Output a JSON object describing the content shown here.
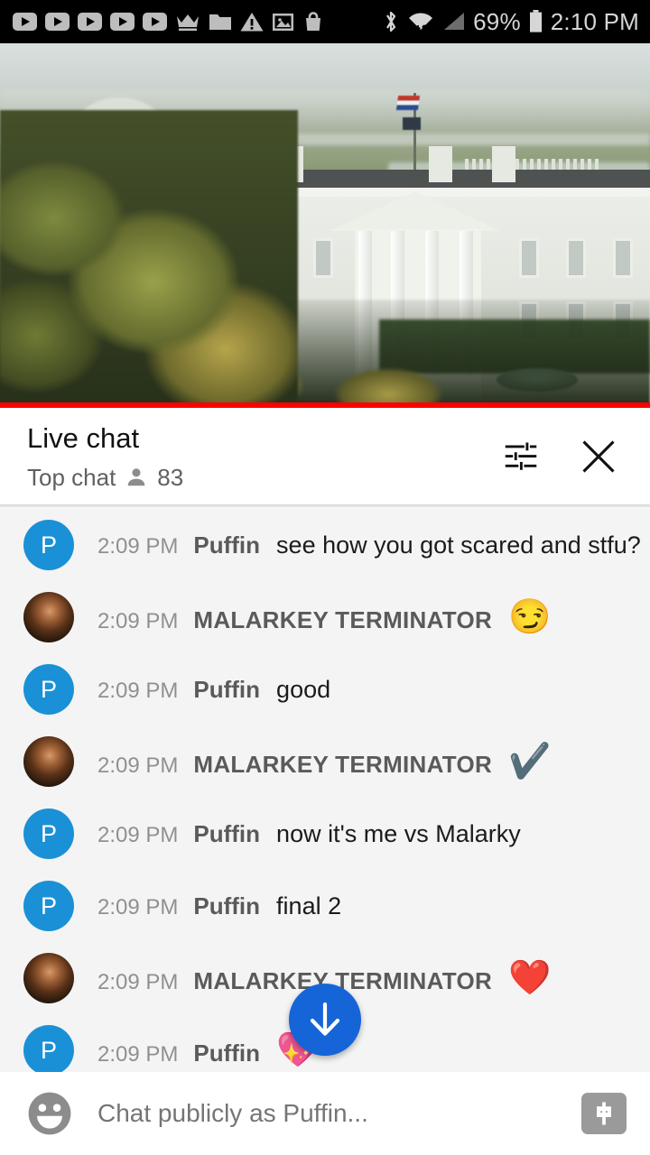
{
  "statusbar": {
    "left_icons": [
      {
        "name": "youtube-notification-icon-1",
        "glyph": "youtube"
      },
      {
        "name": "youtube-notification-icon-2",
        "glyph": "youtube"
      },
      {
        "name": "youtube-notification-icon-3",
        "glyph": "youtube"
      },
      {
        "name": "youtube-notification-icon-4",
        "glyph": "youtube"
      },
      {
        "name": "youtube-notification-icon-5",
        "glyph": "youtube"
      },
      {
        "name": "crown-icon",
        "glyph": "crown"
      },
      {
        "name": "folder-icon",
        "glyph": "folder"
      },
      {
        "name": "warning-icon",
        "glyph": "warning"
      },
      {
        "name": "image-icon",
        "glyph": "image"
      },
      {
        "name": "shopping-bag-icon",
        "glyph": "bag"
      }
    ],
    "bluetooth_icon": "bluetooth-icon",
    "wifi_icon": "wifi-icon",
    "signal_icon": "cellular-signal-icon",
    "battery_percent": "69%",
    "battery_icon": "battery-icon",
    "clock": "2:10 PM",
    "background_color": "#000000",
    "foreground_color": "#d6d6d6"
  },
  "video": {
    "description": "Live video stream of the White House with autumn trees",
    "live_progress_color": "#ff0000"
  },
  "chat_header": {
    "title": "Live chat",
    "subtitle": "Top chat",
    "viewer_count": "83",
    "person_icon": "person-icon",
    "settings_icon": "chat-settings-icon",
    "close_icon": "close-icon"
  },
  "messages": [
    {
      "time": "2:09 PM",
      "author": "Puffin",
      "text": "see how you got scared and stfu?",
      "emoji": "",
      "avatar_type": "letter",
      "avatar_letter": "P",
      "avatar_color": "#1a91d6",
      "author_caps": false
    },
    {
      "time": "2:09 PM",
      "author": "MALARKEY TERMINATOR",
      "text": "",
      "emoji": "😏",
      "avatar_type": "photo",
      "avatar_letter": "",
      "avatar_color": "",
      "author_caps": true
    },
    {
      "time": "2:09 PM",
      "author": "Puffin",
      "text": "good",
      "emoji": "",
      "avatar_type": "letter",
      "avatar_letter": "P",
      "avatar_color": "#1a91d6",
      "author_caps": false
    },
    {
      "time": "2:09 PM",
      "author": "MALARKEY TERMINATOR",
      "text": "",
      "emoji": "✔️",
      "avatar_type": "photo",
      "avatar_letter": "",
      "avatar_color": "",
      "author_caps": true
    },
    {
      "time": "2:09 PM",
      "author": "Puffin",
      "text": "now it's me vs Malarky",
      "emoji": "",
      "avatar_type": "letter",
      "avatar_letter": "P",
      "avatar_color": "#1a91d6",
      "author_caps": false
    },
    {
      "time": "2:09 PM",
      "author": "Puffin",
      "text": "final 2",
      "emoji": "",
      "avatar_type": "letter",
      "avatar_letter": "P",
      "avatar_color": "#1a91d6",
      "author_caps": false
    },
    {
      "time": "2:09 PM",
      "author": "MALARKEY TERMINATOR",
      "text": "",
      "emoji": "❤️",
      "avatar_type": "photo",
      "avatar_letter": "",
      "avatar_color": "",
      "author_caps": true
    },
    {
      "time": "2:09 PM",
      "author": "Puffin",
      "text": "",
      "emoji": "💖",
      "avatar_type": "letter",
      "avatar_letter": "P",
      "avatar_color": "#1a91d6",
      "author_caps": false
    }
  ],
  "scroll_fab": {
    "icon": "arrow-down-icon",
    "color": "#1565d8"
  },
  "input_bar": {
    "emoji_icon": "emoji-smiley-icon",
    "placeholder": "Chat publicly as Puffin...",
    "superchat_icon": "superchat-dollar-icon"
  }
}
